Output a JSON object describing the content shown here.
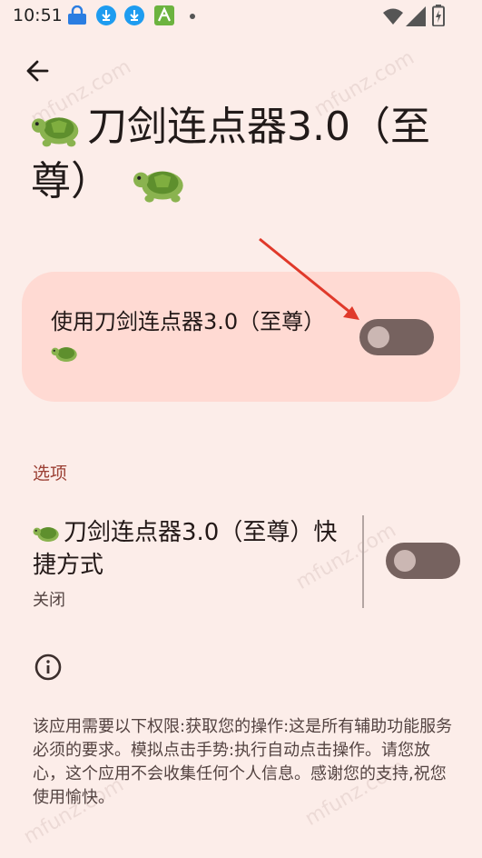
{
  "status_bar": {
    "time": "10:51",
    "icons": [
      "vpn-icon",
      "download-icon",
      "download-icon",
      "app-icon",
      "wifi-icon",
      "signal-icon",
      "battery-icon"
    ]
  },
  "header": {
    "back_icon": "arrow-back-icon",
    "title": "刀剑连点器3.0（至尊）"
  },
  "main_toggle": {
    "label": "使用刀剑连点器3.0（至尊）",
    "state": "off"
  },
  "options": {
    "section_title": "选项",
    "shortcut": {
      "title": "刀剑连点器3.0（至尊）快捷方式",
      "summary": "关闭",
      "state": "off"
    }
  },
  "info": {
    "icon": "info-icon",
    "text": "该应用需要以下权限:获取您的操作:这是所有辅助功能服务必须的要求。模拟点击手势:执行自动点击操作。请您放心，这个应用不会收集任何个人信息。感谢您的支持,祝您使用愉快。"
  },
  "watermark": "mfunz.com",
  "colors": {
    "background": "#fcede9",
    "card": "#ffdad3",
    "switch_track": "#76625f",
    "switch_thumb": "#cbb7b3",
    "accent": "#9b3f33",
    "annotation": "#e0392a"
  }
}
